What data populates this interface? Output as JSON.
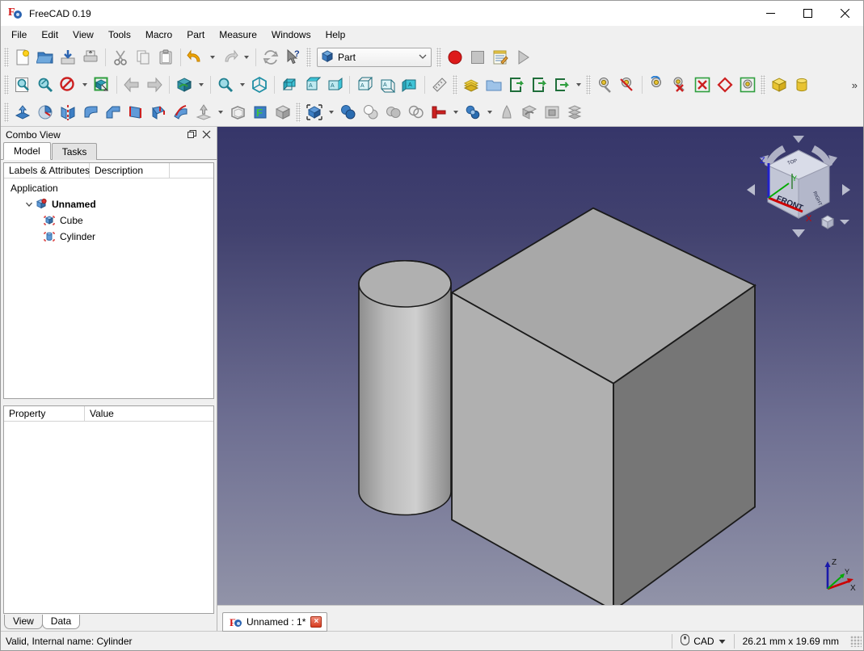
{
  "window": {
    "title": "FreeCAD 0.19",
    "app_icon": "freecad-logo-icon",
    "minimize_label": "Minimize",
    "maximize_label": "Maximize",
    "close_label": "Close"
  },
  "menubar": {
    "items": [
      {
        "label": "File"
      },
      {
        "label": "Edit"
      },
      {
        "label": "View"
      },
      {
        "label": "Tools"
      },
      {
        "label": "Macro"
      },
      {
        "label": "Part"
      },
      {
        "label": "Measure"
      },
      {
        "label": "Windows"
      },
      {
        "label": "Help"
      }
    ]
  },
  "toolbars": {
    "workbench": {
      "selected": "Part",
      "icon": "blue-cube-icon"
    },
    "overflow_label": "»",
    "file": [
      {
        "name": "new-document-button",
        "tooltip": "New"
      },
      {
        "name": "open-document-button",
        "tooltip": "Open"
      },
      {
        "name": "save-document-button",
        "tooltip": "Save"
      },
      {
        "name": "print-document-button",
        "tooltip": "Print"
      },
      {
        "name": "cut-button",
        "tooltip": "Cut"
      },
      {
        "name": "copy-button",
        "tooltip": "Copy"
      },
      {
        "name": "paste-button",
        "tooltip": "Paste"
      },
      {
        "name": "undo-button",
        "tooltip": "Undo"
      },
      {
        "name": "redo-button",
        "tooltip": "Redo"
      },
      {
        "name": "refresh-button",
        "tooltip": "Refresh"
      },
      {
        "name": "whats-this-button",
        "tooltip": "What's This"
      }
    ],
    "macro": [
      {
        "name": "macro-record-button",
        "tooltip": "Macro recording"
      },
      {
        "name": "macro-stop-button",
        "tooltip": "Stop macro recording"
      },
      {
        "name": "macro-edit-button",
        "tooltip": "Macros"
      },
      {
        "name": "macro-execute-button",
        "tooltip": "Execute macro"
      }
    ],
    "view": [
      {
        "name": "fit-all-button",
        "tooltip": "Fit all"
      },
      {
        "name": "fit-selection-button",
        "tooltip": "Fit selection"
      },
      {
        "name": "draw-style-button",
        "tooltip": "Draw style"
      },
      {
        "name": "selection-view-button",
        "tooltip": "Selection view"
      },
      {
        "name": "back-view-button",
        "tooltip": "Previous view"
      },
      {
        "name": "forward-view-button",
        "tooltip": "Next view"
      },
      {
        "name": "axonometric-button",
        "tooltip": "Axonometric"
      },
      {
        "name": "zoom-box-button",
        "tooltip": "Zoom"
      },
      {
        "name": "isometric-view-button",
        "tooltip": "Isometric"
      },
      {
        "name": "front-view-button",
        "tooltip": "Front"
      },
      {
        "name": "top-view-button",
        "tooltip": "Top"
      },
      {
        "name": "right-view-button",
        "tooltip": "Right"
      },
      {
        "name": "rear-view-button",
        "tooltip": "Rear"
      },
      {
        "name": "bottom-view-button",
        "tooltip": "Bottom"
      },
      {
        "name": "left-view-button",
        "tooltip": "Left"
      },
      {
        "name": "measure-button",
        "tooltip": "Measure"
      }
    ],
    "structure": [
      {
        "name": "create-part-button",
        "tooltip": "Create part"
      },
      {
        "name": "create-group-button",
        "tooltip": "Create group"
      },
      {
        "name": "make-link-button",
        "tooltip": "Make link"
      },
      {
        "name": "make-sublink-button",
        "tooltip": "Make sub-link"
      },
      {
        "name": "link-actions-button",
        "tooltip": "Link actions"
      }
    ],
    "visibility": [
      {
        "name": "toggle-visibility-button",
        "tooltip": "Toggle visibility"
      },
      {
        "name": "toggle-axis-cross-button",
        "tooltip": "Toggle axis cross"
      },
      {
        "name": "toggle-all-button",
        "tooltip": "Toggle all"
      },
      {
        "name": "hide-selection-button",
        "tooltip": "Hide selection"
      },
      {
        "name": "show-selection-button",
        "tooltip": "Show selection"
      },
      {
        "name": "toggle-selectability-button",
        "tooltip": "Toggle selectability"
      },
      {
        "name": "show-all-button",
        "tooltip": "Show all objects"
      }
    ],
    "primitives": [
      {
        "name": "part-box-button",
        "tooltip": "Cube"
      },
      {
        "name": "part-cylinder-button",
        "tooltip": "Cylinder"
      }
    ],
    "part_tools": [
      {
        "name": "extrude-button",
        "tooltip": "Extrude"
      },
      {
        "name": "revolve-button",
        "tooltip": "Revolve"
      },
      {
        "name": "mirror-button",
        "tooltip": "Mirroring"
      },
      {
        "name": "fillet-button",
        "tooltip": "Fillet"
      },
      {
        "name": "chamfer-button",
        "tooltip": "Chamfer"
      },
      {
        "name": "ruled-surface-button",
        "tooltip": "Ruled surface"
      },
      {
        "name": "loft-button",
        "tooltip": "Loft"
      },
      {
        "name": "sweep-button",
        "tooltip": "Sweep"
      },
      {
        "name": "offset-button",
        "tooltip": "3D offset"
      },
      {
        "name": "thickness-button",
        "tooltip": "Thickness"
      },
      {
        "name": "projection-button",
        "tooltip": "Projection on surface"
      },
      {
        "name": "shape-builder-button",
        "tooltip": "Shape builder"
      }
    ],
    "boolean": [
      {
        "name": "boolean-button",
        "tooltip": "Boolean"
      },
      {
        "name": "union-button",
        "tooltip": "Union"
      },
      {
        "name": "cut-shape-button",
        "tooltip": "Cut"
      },
      {
        "name": "common-button",
        "tooltip": "Intersection"
      },
      {
        "name": "section-button",
        "tooltip": "Section"
      },
      {
        "name": "cross-sections-button",
        "tooltip": "Cross-sections"
      },
      {
        "name": "join-button",
        "tooltip": "Join objects"
      },
      {
        "name": "split-button",
        "tooltip": "Split"
      },
      {
        "name": "compound-button",
        "tooltip": "Compound"
      },
      {
        "name": "convert-to-solid-button",
        "tooltip": "Convert to solid"
      },
      {
        "name": "reverse-shapes-button",
        "tooltip": "Reverse shapes"
      },
      {
        "name": "check-geometry-button",
        "tooltip": "Check geometry"
      }
    ]
  },
  "combo_view": {
    "title": "Combo View",
    "float_label": "Float",
    "close_label": "Close",
    "tabs": [
      {
        "label": "Model",
        "active": true
      },
      {
        "label": "Tasks",
        "active": false
      }
    ],
    "tree": {
      "columns": [
        "Labels & Attributes",
        "Description",
        ""
      ],
      "nodes": [
        {
          "label": "Application",
          "level": 1,
          "icon": "none",
          "bold": false,
          "expanded": null
        },
        {
          "label": "Unnamed",
          "level": 2,
          "icon": "document-icon",
          "bold": true,
          "expanded": true
        },
        {
          "label": "Cube",
          "level": 3,
          "icon": "box-icon",
          "bold": false,
          "expanded": null
        },
        {
          "label": "Cylinder",
          "level": 3,
          "icon": "cylinder-icon",
          "bold": false,
          "expanded": null
        }
      ]
    },
    "properties": {
      "columns": [
        "Property",
        "Value"
      ],
      "rows": [],
      "tabs": [
        {
          "label": "View",
          "active": false
        },
        {
          "label": "Data",
          "active": true
        }
      ]
    }
  },
  "viewport": {
    "navigation_cube": {
      "front_label": "FRONT",
      "top_label": "TOP",
      "right_label": "RIGHT",
      "axis_x": "X",
      "axis_z": "Z",
      "axis_y": "Y"
    },
    "axis_origin": {
      "x": "X",
      "y": "Y",
      "z": "Z"
    },
    "corner_menu": {
      "cube_icon": "view-cube-icon",
      "dropdown_icon": "chevron-down-icon"
    },
    "colors": {
      "background_top": "#36366a",
      "background_bottom": "#9193a8",
      "shape_face_light": "#b3b3b3",
      "shape_face_mid": "#a6a6a6",
      "shape_face_dark": "#767676",
      "edge": "#1a1a1a",
      "axis_x": "#cc0000",
      "axis_y": "#00aa00",
      "axis_z": "#0000cc"
    },
    "objects": [
      "Cube",
      "Cylinder"
    ]
  },
  "document_tabs": [
    {
      "label": "Unnamed : 1*",
      "icon": "freecad-logo-icon",
      "close_label": "×",
      "active": true
    }
  ],
  "statusbar": {
    "message": "Valid, Internal name: Cylinder",
    "navigation_style": "CAD",
    "navigation_icon": "mouse-icon",
    "dimension": "26.21 mm x 19.69 mm"
  }
}
